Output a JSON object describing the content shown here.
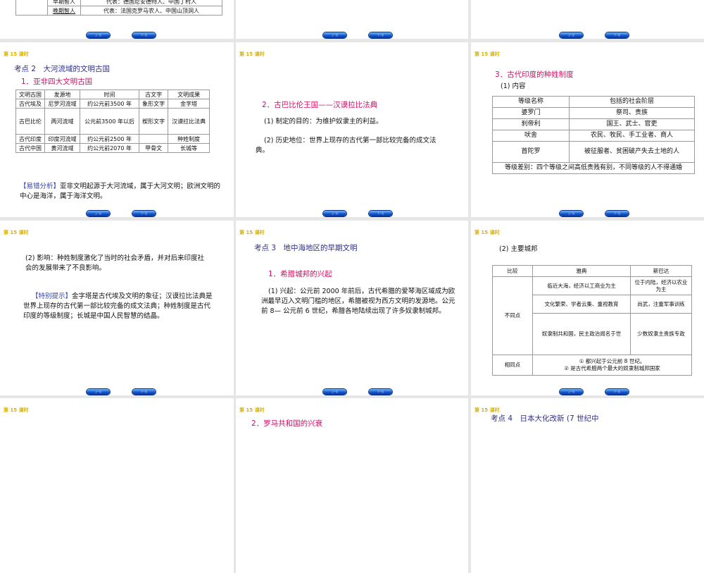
{
  "lesson_label": "第 15 课时",
  "nav": {
    "prev": "上一页",
    "next": "下一页"
  },
  "slide_top_left": {
    "table": [
      [
        "",
        "早期智人",
        "代表：德国尼安德特人、中国丁村人"
      ],
      [
        "",
        "晚期智人",
        "代表：法国克罗马农人、中国山顶洞人"
      ]
    ]
  },
  "slide_civ": {
    "heading": "考点 2　大河流域的文明古国",
    "sub": "1．亚非四大文明古国",
    "table": [
      [
        "文明古国",
        "发源地",
        "时间",
        "古文字",
        "文明成果"
      ],
      [
        "古代埃及",
        "尼罗河流域",
        "约公元前3500 年",
        "象形文字",
        "金字塔"
      ],
      [
        "古巴比伦",
        "两河流域",
        "公元前3500 年以后",
        "楔形文字",
        "汉谟拉比法典"
      ],
      [
        "古代印度",
        "印度河流域",
        "约公元前2500 年",
        "",
        "种姓制度"
      ],
      [
        "古代中国",
        "黄河流域",
        "约公元前2070 年",
        "甲骨文",
        "长城等"
      ]
    ],
    "note_label": "【易错分析】",
    "note": "亚非文明起源于大河流域，属于大河文明；欧洲文明的中心是海洋，属于海洋文明。"
  },
  "slide_babylon": {
    "sub": "2．古巴比伦王国——汉谟拉比法典",
    "p1": "(1) 制定的目的：为维护奴隶主的利益。",
    "p2": "(2) 历史地位：世界上现存的古代第一部比较完备的成文法典。"
  },
  "slide_caste": {
    "sub": "3．古代印度的种姓制度",
    "p1": "(1) 内容",
    "table": [
      [
        "等级名称",
        "包括的社会阶层"
      ],
      [
        "婆罗门",
        "祭司、贵族"
      ],
      [
        "刹帝利",
        "国王、武士、官吏"
      ],
      [
        "吠舍",
        "农民、牧民、手工业者、商人"
      ],
      [
        "首陀罗",
        "被征服者、贫困破产失去土地的人"
      ],
      [
        "等级差别：四个等级之间高低贵贱有别，不同等级的人不得通婚"
      ]
    ]
  },
  "slide_impact": {
    "p1": "(2) 影响：种姓制度激化了当时的社会矛盾，并对后来印度社会的发展带来了不良影响。",
    "tip_label": "【特别提示】",
    "tip": "金字塔是古代埃及文明的象征；汉谟拉比法典是世界上现存的古代第一部比较完备的成文法典；种姓制度是古代印度的等级制度；长城是中国人民智慧的结晶。"
  },
  "slide_greece": {
    "heading": "考点 3　地中海地区的早期文明",
    "sub": "1．希腊城邦的兴起",
    "p1": "(1) 兴起：公元前 2000 年前后，古代希腊的爱琴海区域成为欧洲最早迈入文明门槛的地区，希腊被视为西方文明的发源地。公元前 8— 公元前 6 世纪，希腊各地陆续出现了许多奴隶制城邦。"
  },
  "slide_citystates": {
    "p1": "(2) 主要城邦",
    "header": [
      "比较",
      "雅典",
      "斯巴达"
    ],
    "diff_label": "不同点",
    "diffs": [
      [
        "临近大海，经济以工商业为主",
        "位于内陆，经济以农业为主"
      ],
      [
        "文化繁荣、学者云集、重视教育",
        "尚武，注重军事训练"
      ],
      [
        "奴隶制共和国，民主政治闻名于世",
        "少数奴隶主贵族专政"
      ]
    ],
    "same_label": "相同点",
    "same": [
      "① 都兴起于公元前 8 世纪。",
      "② 是古代希腊两个最大的奴隶制城邦国家"
    ]
  },
  "slide_bottom_mid": {
    "sub": "2．罗马共和国的兴衰"
  },
  "slide_bottom_right": {
    "heading": "考点 4　日本大化改新 (7 世纪中"
  }
}
